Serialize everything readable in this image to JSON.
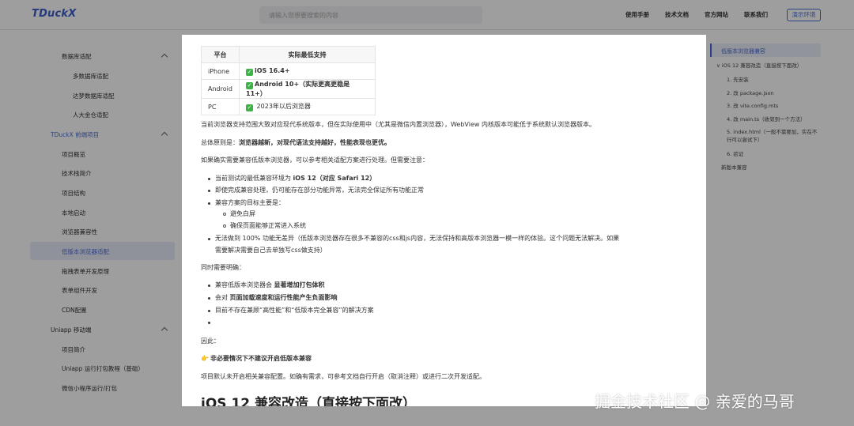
{
  "header": {
    "logo": "TDuckX",
    "search_placeholder": "请输入您想要搜索的内容",
    "nav": [
      "使用手册",
      "技术文档",
      "官方网站",
      "联系我们"
    ],
    "demo_button": "演示环境"
  },
  "sidebar": {
    "items": [
      {
        "label": "数据库适配",
        "level": 1
      },
      {
        "label": "多数据库适配",
        "level": 2
      },
      {
        "label": "达梦数据库适配",
        "level": 2
      },
      {
        "label": "人大金仓适配",
        "level": 2
      },
      {
        "label": "TDuckX 前端项目",
        "level": 0
      },
      {
        "label": "项目概览",
        "level": 1
      },
      {
        "label": "技术栈简介",
        "level": 1
      },
      {
        "label": "项目结构",
        "level": 1
      },
      {
        "label": "本地启动",
        "level": 1
      },
      {
        "label": "浏览器兼容性",
        "level": 1
      },
      {
        "label": "低版本浏览器适配",
        "level": 1
      },
      {
        "label": "拖拽表单开发原理",
        "level": 1
      },
      {
        "label": "表单组件开发",
        "level": 1
      },
      {
        "label": "CDN配置",
        "level": 1
      },
      {
        "label": "Uniapp 移动端",
        "level": 0
      },
      {
        "label": "项目简介",
        "level": 1
      },
      {
        "label": "Uniapp 运行打包教程（基础）",
        "level": 1
      },
      {
        "label": "微信小程序运行/打包",
        "level": 1
      }
    ]
  },
  "toc": {
    "items": [
      "低版本浏览器兼容",
      "iOS 12 兼容改造（直接按下面改）",
      "1. 先安装",
      "2. 改 package.json",
      "3. 改 vite.config.mts",
      "4. 改 main.ts（收敛到一个方法）",
      "5. index.html（一般不需要加，实在不",
      "行可以尝试下）",
      "6. 验证",
      "新版本兼容"
    ]
  },
  "content": {
    "table": {
      "headers": [
        "平台",
        "实际最低支持"
      ],
      "rows": [
        [
          "iPhone",
          "iOS 16.4+"
        ],
        [
          "Android",
          "Android 10+（实际更高更稳是 11+）"
        ],
        [
          "PC",
          "2023年以后浏览器"
        ]
      ]
    },
    "p1": "当前浏览器支持范围大致对应现代系统版本，但在实际使用中（尤其是微信内置浏览器），WebView 内核版本可能低于系统默认浏览器版本。",
    "p2_prefix": "总体原则是：",
    "p2_bold": "浏览器越新，对现代语法支持越好，性能表现也更优。",
    "p3": "如果确实需要兼容低版本浏览器，可以参考相关适配方案进行处理。但需要注意：",
    "list1": [
      {
        "prefix": "当前测试的最低兼容环境为 ",
        "bold": "iOS 12（对应 Safari 12）"
      },
      {
        "prefix": "即使完成兼容处理，仍可能存在部分功能异常，无法完全保证所有功能正常",
        "bold": ""
      },
      {
        "prefix": "兼容方案的目标主要是：",
        "bold": ""
      }
    ],
    "sublist": [
      "避免白屏",
      "确保页面能够正常进入系统"
    ],
    "list1_last_line1": "无法做到 100% 功能无差异（低版本浏览器存在很多不兼容的css和js内容，无法保持和高版本浏览器一模一样的体验。这个问题无法解决。如果",
    "list1_last_line2": "需要解决需要自己去单独写css做支持）",
    "p4": "同时需要明确：",
    "list2": [
      {
        "prefix": "兼容低版本浏览器会 ",
        "bold": "显著增加打包体积"
      },
      {
        "prefix": "会对 ",
        "bold": "页面加载速度和运行性能产生负面影响"
      },
      {
        "prefix": "目前不存在兼顾“高性能”和“低版本完全兼容”的解决方案",
        "bold": ""
      }
    ],
    "p5": "因此：",
    "hand_icon": "👉",
    "p6_bold": "非必要情况下不建议开启低版本兼容",
    "p7": "项目默认未开启相关兼容配置。如确有需求，可参考文档自行开启（取消注释）或进行二次开发适配。",
    "h2": "iOS 12 兼容改造（直接按下面改）"
  },
  "watermark": "掘金技术社区 @ 亲爱的马哥",
  "colors": {
    "accent": "#4a6bd6",
    "check": "#3db247"
  }
}
